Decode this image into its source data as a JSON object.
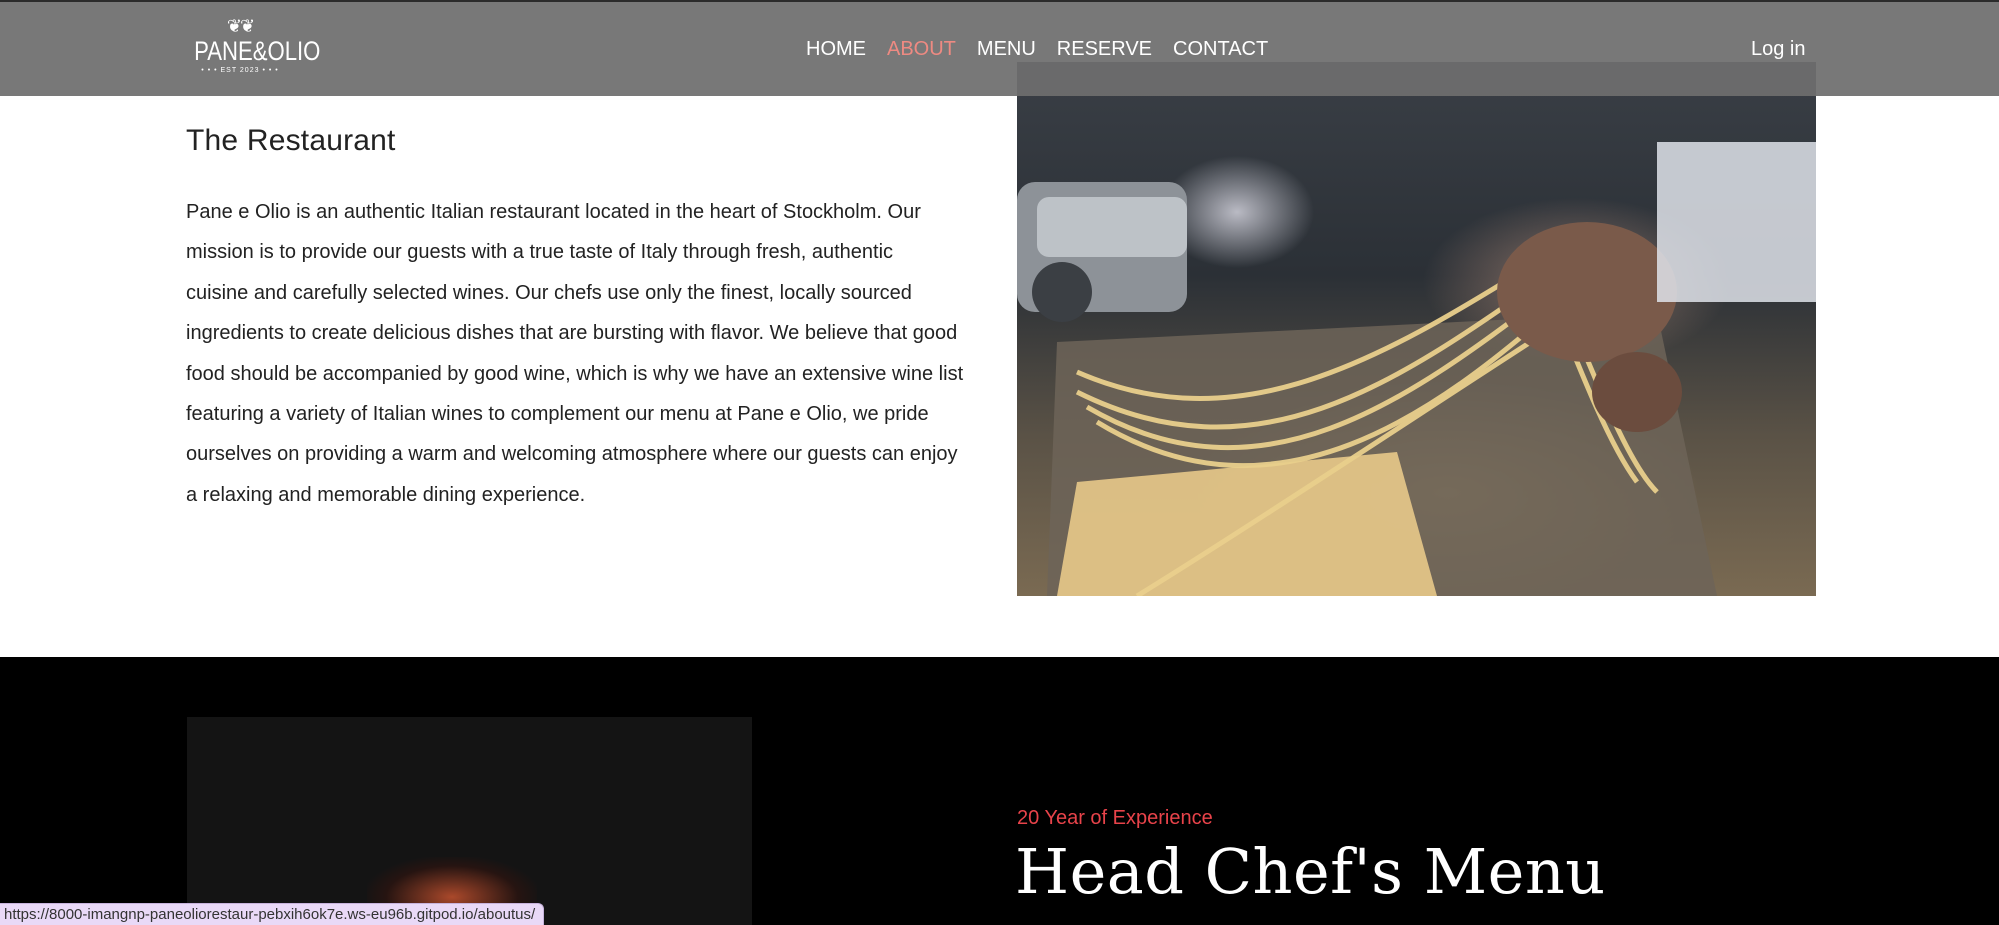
{
  "header": {
    "logo": {
      "brand": "PANE&OLIO",
      "est": "EST 2023"
    },
    "nav": [
      "HOME",
      "ABOUT",
      "MENU",
      "RESERVE",
      "CONTACT"
    ],
    "active_nav": "ABOUT",
    "login_label": "Log in"
  },
  "restaurant": {
    "title": "The Restaurant",
    "lines": [
      "Pane e Olio is an authentic Italian restaurant located in the heart of Stockholm. Our",
      "mission is to provide our guests with a true taste of Italy through fresh, authentic",
      "cuisine and carefully selected wines. Our chefs use only the finest, locally sourced",
      "ingredients to create delicious dishes that are bursting with flavor. We believe that good",
      "food should be accompanied by good wine, which is why we have an extensive wine list",
      "featuring a variety of Italian wines to complement our menu at Pane e Olio, we pride",
      "ourselves on providing a warm and welcoming atmosphere where our guests can enjoy",
      "a relaxing and memorable dining experience."
    ]
  },
  "chef": {
    "subtitle": "20 Year of Experience",
    "heading": "Head Chef's Menu"
  },
  "status_bar": {
    "url": "https://8000-imangnp-paneoliorestaur-pebxih6ok7e.ws-eu96b.gitpod.io/aboutus/"
  },
  "colors": {
    "header_bg": "#6e6e6e",
    "active_nav": "#ee8a82",
    "accent_red": "#e8434a",
    "dark_section": "#000000"
  }
}
